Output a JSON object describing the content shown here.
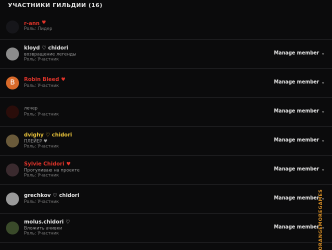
{
  "header": {
    "title": "УЧАСТНИКИ ГИЛЬДИИ (16)"
  },
  "members": [
    {
      "name": "r-ann",
      "name_color": "#e0342a",
      "heart": "♥",
      "heart_color": "#e0342a",
      "status": "",
      "role": "Роль: Лидер",
      "manage": "",
      "avatar_bg": "#16161a",
      "avatar_glyph": ""
    },
    {
      "name": "kloyd ♡ chidori",
      "name_color": "#e6e6e6",
      "heart": "",
      "heart_color": "",
      "status": "возвращение легенды",
      "role": "Роль: Участник",
      "manage": "Manage member",
      "avatar_bg": "#8c8c8c",
      "avatar_glyph": ""
    },
    {
      "name": "Robin Bleed",
      "name_color": "#e0342a",
      "heart": "♥",
      "heart_color": "#e0342a",
      "status": "",
      "role": "Роль: Участник",
      "manage": "Manage member",
      "avatar_bg": "#d96a2a",
      "avatar_glyph": "B"
    },
    {
      "name": "",
      "name_color": "#3fae4a",
      "heart": "",
      "heart_color": "",
      "status": "лечер",
      "role": "Роль: Участник",
      "manage": "Manage member",
      "avatar_bg": "#2a0d0a",
      "avatar_glyph": ""
    },
    {
      "name": "dvighy ♡ chidori",
      "name_color": "#e8c23a",
      "heart": "",
      "heart_color": "",
      "status": "ПЛЕЙЕР ♥",
      "role": "Роль: Участник",
      "manage": "Manage member",
      "avatar_bg": "#6a5a3a",
      "avatar_glyph": ""
    },
    {
      "name": "Sylvie Chidori",
      "name_color": "#e0342a",
      "heart": "♥",
      "heart_color": "#e0342a",
      "status": "Прогуливаю на проекте",
      "role": "Роль: Участник",
      "manage": "Manage member",
      "avatar_bg": "#3a2a2e",
      "avatar_glyph": ""
    },
    {
      "name": "grechkov ♡ chidori",
      "name_color": "#e6e6e6",
      "heart": "",
      "heart_color": "",
      "status": "",
      "role": "Роль: Участник",
      "manage": "Manage member",
      "avatar_bg": "#9a9a9a",
      "avatar_glyph": ""
    },
    {
      "name": "molus.chidori ♡",
      "name_color": "#e6e6e6",
      "heart": "",
      "heart_color": "",
      "status": "Вложить ачивки",
      "role": "Роль: Участник",
      "manage": "Manage member",
      "avatar_bg": "#3a4a2a",
      "avatar_glyph": ""
    }
  ],
  "watermark": {
    "text": "ORANGEMOREGAMES"
  }
}
